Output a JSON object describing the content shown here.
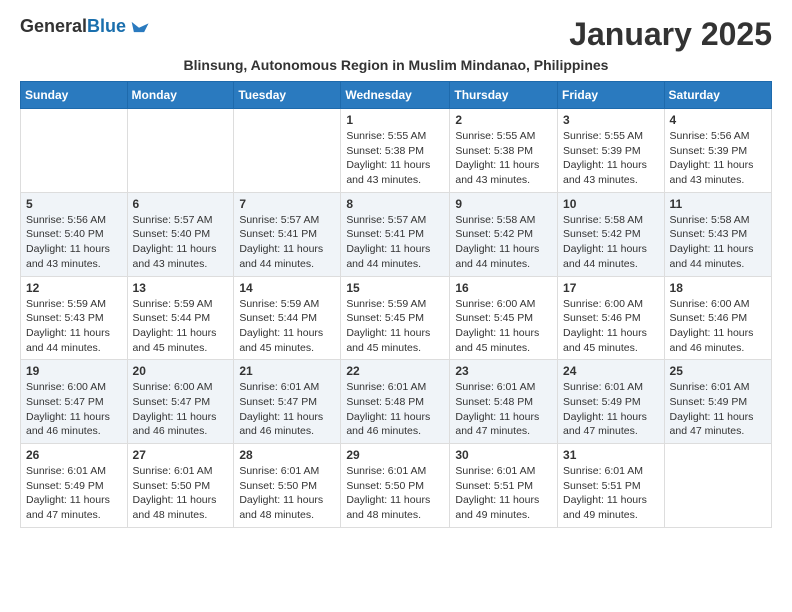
{
  "logo": {
    "general": "General",
    "blue": "Blue"
  },
  "title": "January 2025",
  "subtitle": "Blinsung, Autonomous Region in Muslim Mindanao, Philippines",
  "weekdays": [
    "Sunday",
    "Monday",
    "Tuesday",
    "Wednesday",
    "Thursday",
    "Friday",
    "Saturday"
  ],
  "weeks": [
    [
      {
        "day": "",
        "text": ""
      },
      {
        "day": "",
        "text": ""
      },
      {
        "day": "",
        "text": ""
      },
      {
        "day": "1",
        "text": "Sunrise: 5:55 AM\nSunset: 5:38 PM\nDaylight: 11 hours\nand 43 minutes."
      },
      {
        "day": "2",
        "text": "Sunrise: 5:55 AM\nSunset: 5:38 PM\nDaylight: 11 hours\nand 43 minutes."
      },
      {
        "day": "3",
        "text": "Sunrise: 5:55 AM\nSunset: 5:39 PM\nDaylight: 11 hours\nand 43 minutes."
      },
      {
        "day": "4",
        "text": "Sunrise: 5:56 AM\nSunset: 5:39 PM\nDaylight: 11 hours\nand 43 minutes."
      }
    ],
    [
      {
        "day": "5",
        "text": "Sunrise: 5:56 AM\nSunset: 5:40 PM\nDaylight: 11 hours\nand 43 minutes."
      },
      {
        "day": "6",
        "text": "Sunrise: 5:57 AM\nSunset: 5:40 PM\nDaylight: 11 hours\nand 43 minutes."
      },
      {
        "day": "7",
        "text": "Sunrise: 5:57 AM\nSunset: 5:41 PM\nDaylight: 11 hours\nand 44 minutes."
      },
      {
        "day": "8",
        "text": "Sunrise: 5:57 AM\nSunset: 5:41 PM\nDaylight: 11 hours\nand 44 minutes."
      },
      {
        "day": "9",
        "text": "Sunrise: 5:58 AM\nSunset: 5:42 PM\nDaylight: 11 hours\nand 44 minutes."
      },
      {
        "day": "10",
        "text": "Sunrise: 5:58 AM\nSunset: 5:42 PM\nDaylight: 11 hours\nand 44 minutes."
      },
      {
        "day": "11",
        "text": "Sunrise: 5:58 AM\nSunset: 5:43 PM\nDaylight: 11 hours\nand 44 minutes."
      }
    ],
    [
      {
        "day": "12",
        "text": "Sunrise: 5:59 AM\nSunset: 5:43 PM\nDaylight: 11 hours\nand 44 minutes."
      },
      {
        "day": "13",
        "text": "Sunrise: 5:59 AM\nSunset: 5:44 PM\nDaylight: 11 hours\nand 45 minutes."
      },
      {
        "day": "14",
        "text": "Sunrise: 5:59 AM\nSunset: 5:44 PM\nDaylight: 11 hours\nand 45 minutes."
      },
      {
        "day": "15",
        "text": "Sunrise: 5:59 AM\nSunset: 5:45 PM\nDaylight: 11 hours\nand 45 minutes."
      },
      {
        "day": "16",
        "text": "Sunrise: 6:00 AM\nSunset: 5:45 PM\nDaylight: 11 hours\nand 45 minutes."
      },
      {
        "day": "17",
        "text": "Sunrise: 6:00 AM\nSunset: 5:46 PM\nDaylight: 11 hours\nand 45 minutes."
      },
      {
        "day": "18",
        "text": "Sunrise: 6:00 AM\nSunset: 5:46 PM\nDaylight: 11 hours\nand 46 minutes."
      }
    ],
    [
      {
        "day": "19",
        "text": "Sunrise: 6:00 AM\nSunset: 5:47 PM\nDaylight: 11 hours\nand 46 minutes."
      },
      {
        "day": "20",
        "text": "Sunrise: 6:00 AM\nSunset: 5:47 PM\nDaylight: 11 hours\nand 46 minutes."
      },
      {
        "day": "21",
        "text": "Sunrise: 6:01 AM\nSunset: 5:47 PM\nDaylight: 11 hours\nand 46 minutes."
      },
      {
        "day": "22",
        "text": "Sunrise: 6:01 AM\nSunset: 5:48 PM\nDaylight: 11 hours\nand 46 minutes."
      },
      {
        "day": "23",
        "text": "Sunrise: 6:01 AM\nSunset: 5:48 PM\nDaylight: 11 hours\nand 47 minutes."
      },
      {
        "day": "24",
        "text": "Sunrise: 6:01 AM\nSunset: 5:49 PM\nDaylight: 11 hours\nand 47 minutes."
      },
      {
        "day": "25",
        "text": "Sunrise: 6:01 AM\nSunset: 5:49 PM\nDaylight: 11 hours\nand 47 minutes."
      }
    ],
    [
      {
        "day": "26",
        "text": "Sunrise: 6:01 AM\nSunset: 5:49 PM\nDaylight: 11 hours\nand 47 minutes."
      },
      {
        "day": "27",
        "text": "Sunrise: 6:01 AM\nSunset: 5:50 PM\nDaylight: 11 hours\nand 48 minutes."
      },
      {
        "day": "28",
        "text": "Sunrise: 6:01 AM\nSunset: 5:50 PM\nDaylight: 11 hours\nand 48 minutes."
      },
      {
        "day": "29",
        "text": "Sunrise: 6:01 AM\nSunset: 5:50 PM\nDaylight: 11 hours\nand 48 minutes."
      },
      {
        "day": "30",
        "text": "Sunrise: 6:01 AM\nSunset: 5:51 PM\nDaylight: 11 hours\nand 49 minutes."
      },
      {
        "day": "31",
        "text": "Sunrise: 6:01 AM\nSunset: 5:51 PM\nDaylight: 11 hours\nand 49 minutes."
      },
      {
        "day": "",
        "text": ""
      }
    ]
  ]
}
